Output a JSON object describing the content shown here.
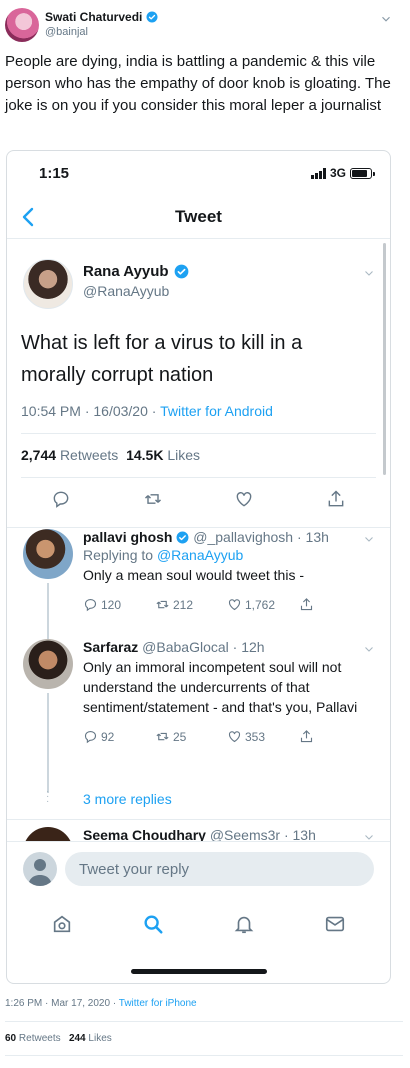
{
  "outer": {
    "name": "Swati Chaturvedi",
    "handle": "@bainjal",
    "text": "People are dying, india is battling a pandemic & this vile person who has the empathy of door knob is gloating. The joke is on you if you consider this moral leper a journalist",
    "time": "1:26 PM · Mar 17, 2020 · ",
    "source": "Twitter for iPhone",
    "retweets_count": "60",
    "retweets_label": "Retweets",
    "likes_count": "244",
    "likes_label": "Likes"
  },
  "phone": {
    "status_time": "1:15",
    "network": "3G",
    "battery_level": 0.85,
    "nav_title": "Tweet",
    "main_tweet": {
      "name": "Rana Ayyub",
      "handle": "@RanaAyyub",
      "text": "What is left for a virus to kill in a morally corrupt nation",
      "time": "10:54 PM · 16/03/20 · ",
      "source": "Twitter for Android",
      "retweets_count": "2,744",
      "retweets_label": "Retweets",
      "likes_count": "14.5K",
      "likes_label": "Likes"
    },
    "replies": [
      {
        "name": "pallavi ghosh",
        "handle": "@_pallavighosh",
        "age": "· 13h",
        "replying_prefix": "Replying to ",
        "replying_to": "@RanaAyyub",
        "text": "Only a mean soul would tweet this -",
        "replies": "120",
        "retweets": "212",
        "likes": "1,762"
      },
      {
        "name": "Sarfaraz",
        "handle": "@BabaGlocal",
        "age": "· 12h",
        "text": "Only an immoral incompetent soul will not understand the undercurrents of that sentiment/statement - and that's you, Pallavi",
        "replies": "92",
        "retweets": "25",
        "likes": "353"
      },
      {
        "name": "Seema Choudhary",
        "handle": "@Seems3r",
        "age": "· 13h"
      }
    ],
    "more_replies": "3 more replies",
    "compose_placeholder": "Tweet your reply"
  },
  "colors": {
    "accent": "#1da1f2",
    "text": "#14171a",
    "muted": "#657786"
  }
}
